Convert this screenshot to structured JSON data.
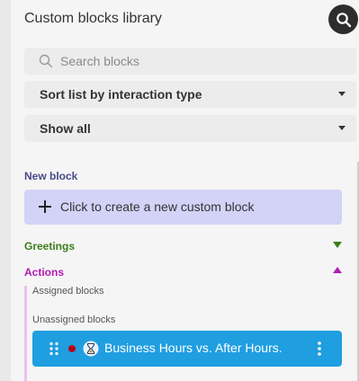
{
  "panel": {
    "title": "Custom blocks library",
    "search_button_icon": "search-icon"
  },
  "search": {
    "placeholder": "Search blocks",
    "value": ""
  },
  "sort": {
    "selected": "Sort list by interaction type"
  },
  "filter": {
    "selected": "Show all"
  },
  "new_block": {
    "section_label": "New block",
    "create_label": "Click to create a new custom block"
  },
  "categories": [
    {
      "name": "Greetings",
      "color": "#3a7d1a",
      "expanded": false
    },
    {
      "name": "Actions",
      "color": "#b21bb2",
      "expanded": true
    }
  ],
  "actions": {
    "assigned_label": "Assigned blocks",
    "unassigned_label": "Unassigned blocks",
    "blocks": [
      {
        "name": "Business Hours vs. After Hours.",
        "status_color": "#b80018",
        "icon": "hourglass-icon",
        "background": "#1f9ee0"
      }
    ]
  }
}
